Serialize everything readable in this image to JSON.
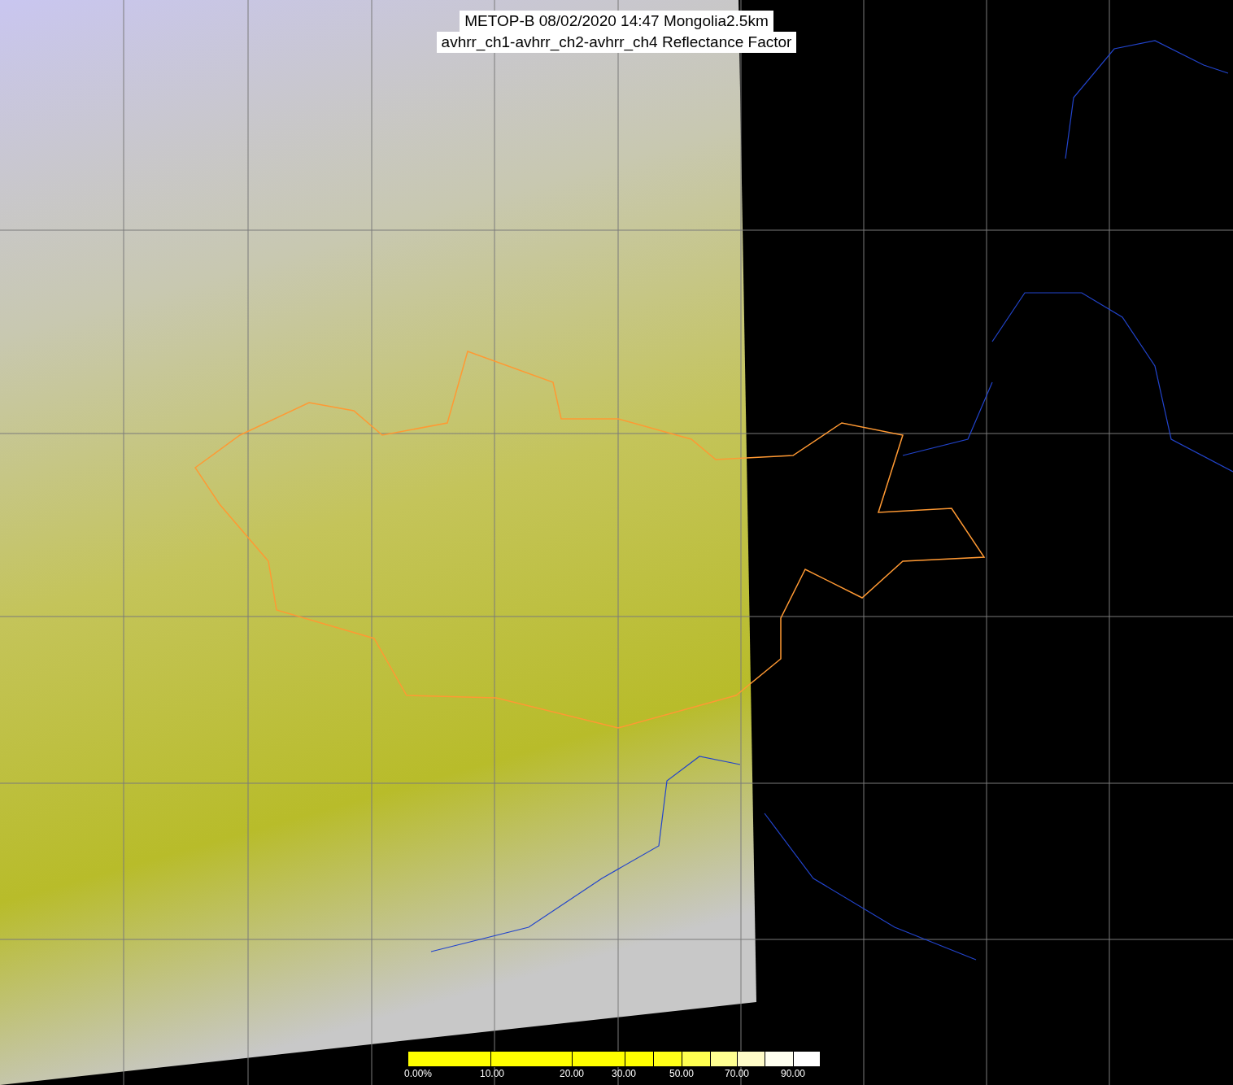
{
  "title": {
    "lines": [
      "METOP-B 08/02/2020 14:47 Mongolia2.5km",
      "avhrr_ch1-avhrr_ch2-avhrr_ch4 Reflectance Factor"
    ]
  },
  "colorbar": {
    "segments": [
      {
        "color": "#ffff00"
      },
      {
        "color": "#ffff00"
      },
      {
        "color": "#ffff00"
      },
      {
        "color": "#ffff00"
      },
      {
        "color": "#ffff18"
      },
      {
        "color": "#ffff50"
      },
      {
        "color": "#ffff90"
      },
      {
        "color": "#fffcc8"
      },
      {
        "color": "#fffff0"
      },
      {
        "color": "#ffffff"
      }
    ],
    "tick_labels": [
      "0.00%",
      "10.00",
      "20.00",
      "30.00",
      "50.00",
      "70.00",
      "90.00"
    ]
  }
}
